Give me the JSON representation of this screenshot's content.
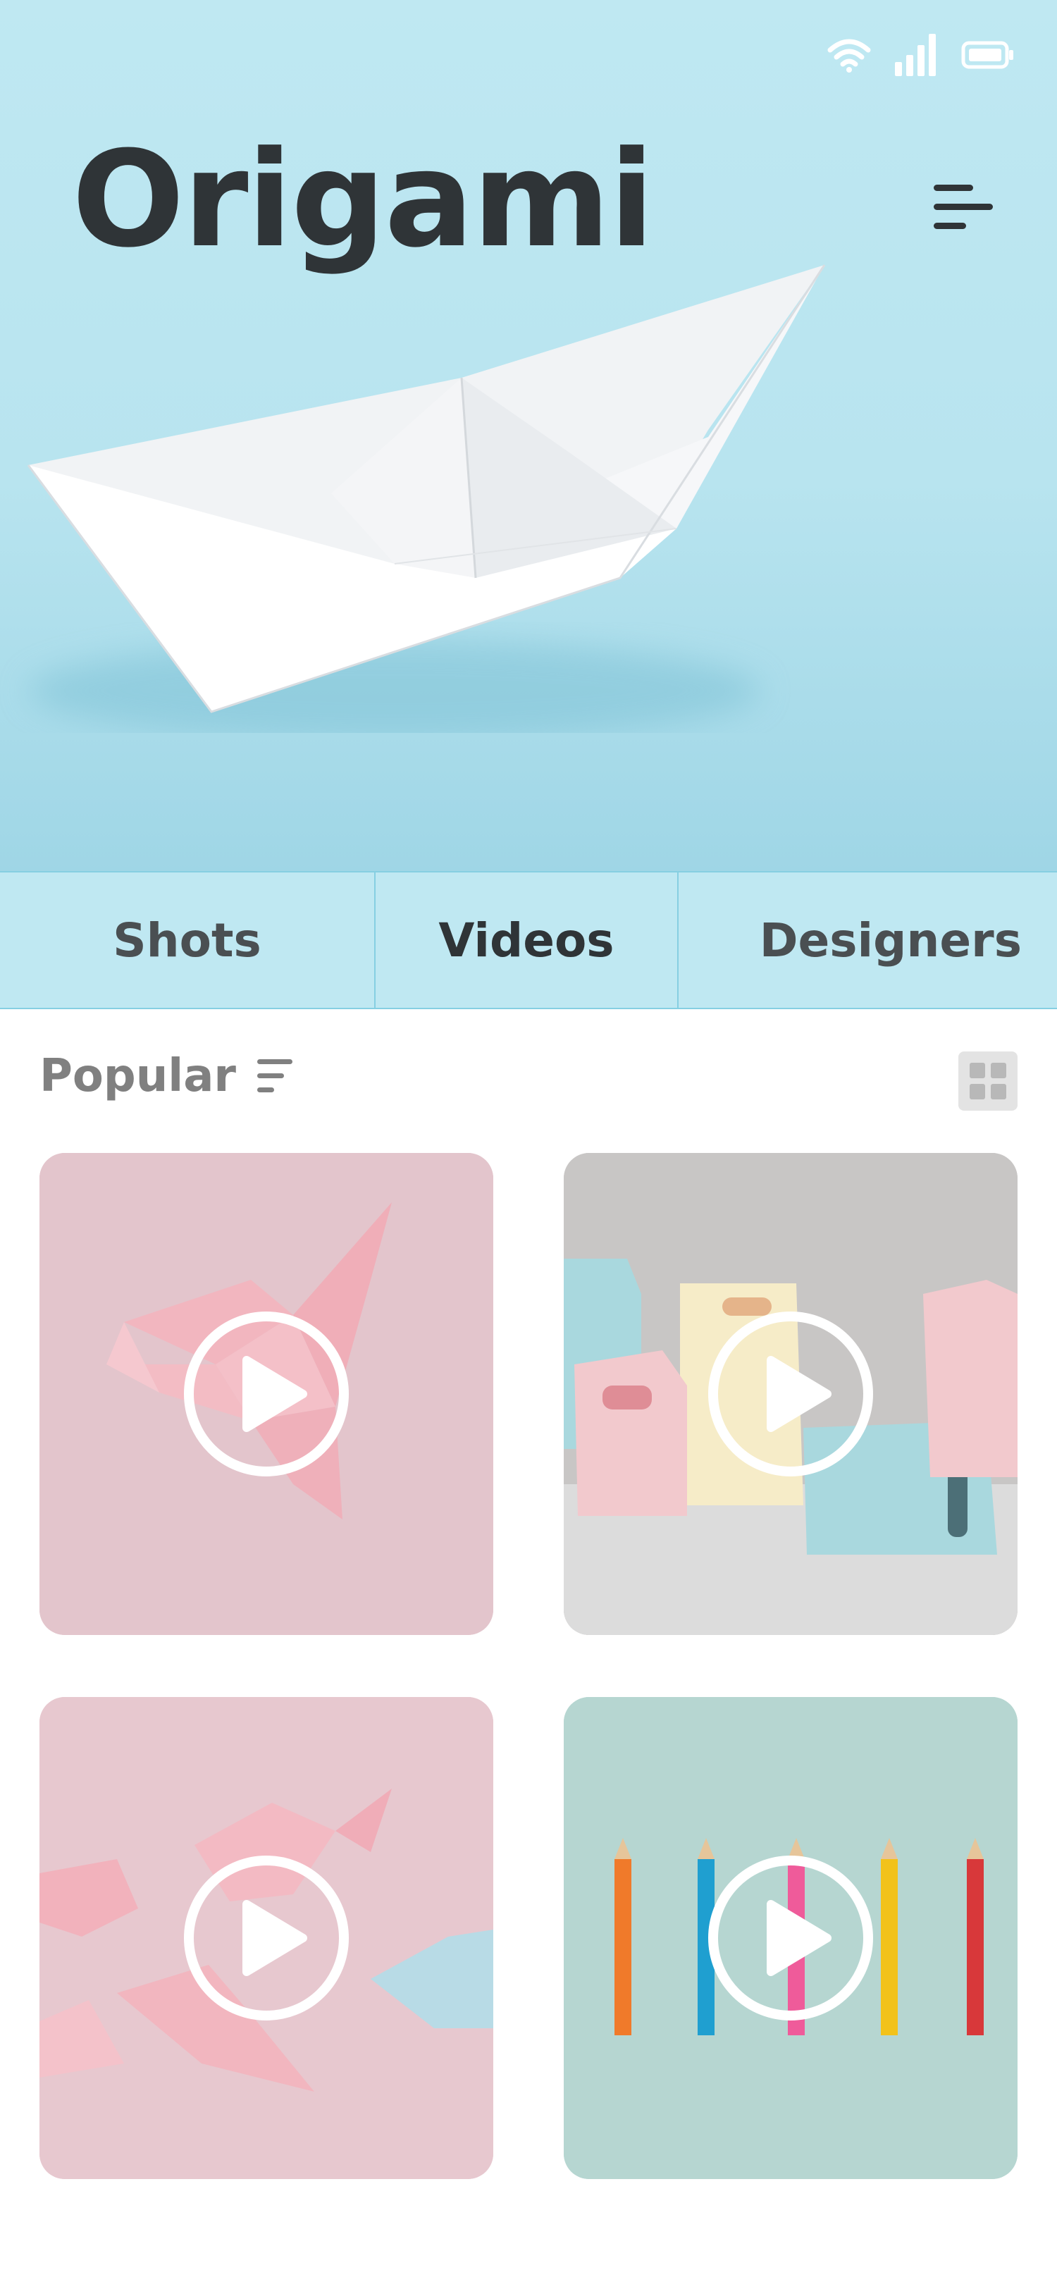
{
  "app": {
    "title": "Origami"
  },
  "status_bar": {
    "icons": [
      "wifi-icon",
      "signal-icon",
      "battery-icon"
    ]
  },
  "header": {
    "menu_icon": "hamburger-menu-icon"
  },
  "tabs": [
    {
      "label": "Shots"
    },
    {
      "label": "Videos"
    },
    {
      "label": "Designers"
    }
  ],
  "section": {
    "title": "Popular",
    "sort_icon": "sort-lines-icon",
    "view_toggle_icon": "grid-view-icon"
  },
  "videos": [
    {
      "subject": "pink origami crane",
      "icon": "play-icon"
    },
    {
      "subject": "pastel paper gift bags",
      "icon": "play-icon"
    },
    {
      "subject": "pink and blue origami birds",
      "icon": "play-icon"
    },
    {
      "subject": "colored pencils",
      "icon": "play-icon"
    }
  ],
  "colors": {
    "hero_background": "#bfe8f2",
    "tab_border": "#86cfe2",
    "title_text": "#2f3437",
    "section_text": "#808080"
  }
}
